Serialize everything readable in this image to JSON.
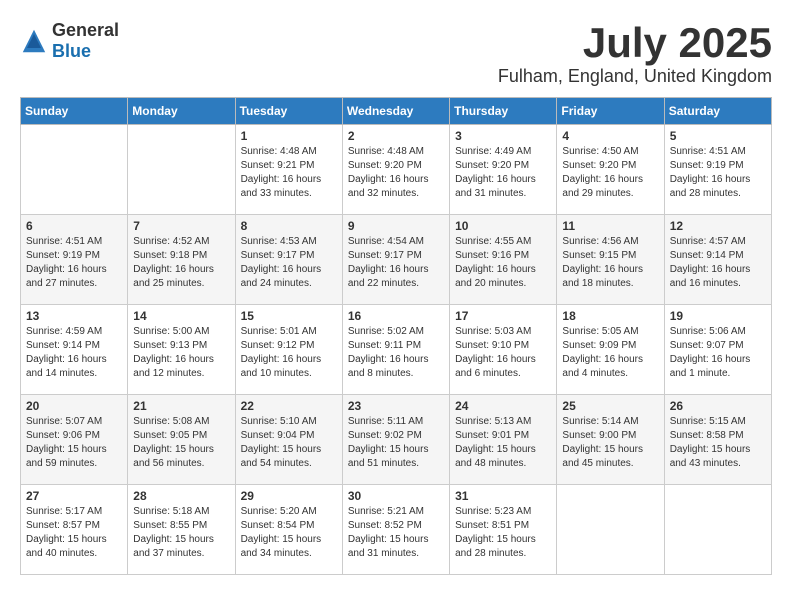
{
  "header": {
    "logo_general": "General",
    "logo_blue": "Blue",
    "month": "July 2025",
    "location": "Fulham, England, United Kingdom"
  },
  "days_of_week": [
    "Sunday",
    "Monday",
    "Tuesday",
    "Wednesday",
    "Thursday",
    "Friday",
    "Saturday"
  ],
  "weeks": [
    [
      {
        "day": "",
        "content": ""
      },
      {
        "day": "",
        "content": ""
      },
      {
        "day": "1",
        "content": "Sunrise: 4:48 AM\nSunset: 9:21 PM\nDaylight: 16 hours\nand 33 minutes."
      },
      {
        "day": "2",
        "content": "Sunrise: 4:48 AM\nSunset: 9:20 PM\nDaylight: 16 hours\nand 32 minutes."
      },
      {
        "day": "3",
        "content": "Sunrise: 4:49 AM\nSunset: 9:20 PM\nDaylight: 16 hours\nand 31 minutes."
      },
      {
        "day": "4",
        "content": "Sunrise: 4:50 AM\nSunset: 9:20 PM\nDaylight: 16 hours\nand 29 minutes."
      },
      {
        "day": "5",
        "content": "Sunrise: 4:51 AM\nSunset: 9:19 PM\nDaylight: 16 hours\nand 28 minutes."
      }
    ],
    [
      {
        "day": "6",
        "content": "Sunrise: 4:51 AM\nSunset: 9:19 PM\nDaylight: 16 hours\nand 27 minutes."
      },
      {
        "day": "7",
        "content": "Sunrise: 4:52 AM\nSunset: 9:18 PM\nDaylight: 16 hours\nand 25 minutes."
      },
      {
        "day": "8",
        "content": "Sunrise: 4:53 AM\nSunset: 9:17 PM\nDaylight: 16 hours\nand 24 minutes."
      },
      {
        "day": "9",
        "content": "Sunrise: 4:54 AM\nSunset: 9:17 PM\nDaylight: 16 hours\nand 22 minutes."
      },
      {
        "day": "10",
        "content": "Sunrise: 4:55 AM\nSunset: 9:16 PM\nDaylight: 16 hours\nand 20 minutes."
      },
      {
        "day": "11",
        "content": "Sunrise: 4:56 AM\nSunset: 9:15 PM\nDaylight: 16 hours\nand 18 minutes."
      },
      {
        "day": "12",
        "content": "Sunrise: 4:57 AM\nSunset: 9:14 PM\nDaylight: 16 hours\nand 16 minutes."
      }
    ],
    [
      {
        "day": "13",
        "content": "Sunrise: 4:59 AM\nSunset: 9:14 PM\nDaylight: 16 hours\nand 14 minutes."
      },
      {
        "day": "14",
        "content": "Sunrise: 5:00 AM\nSunset: 9:13 PM\nDaylight: 16 hours\nand 12 minutes."
      },
      {
        "day": "15",
        "content": "Sunrise: 5:01 AM\nSunset: 9:12 PM\nDaylight: 16 hours\nand 10 minutes."
      },
      {
        "day": "16",
        "content": "Sunrise: 5:02 AM\nSunset: 9:11 PM\nDaylight: 16 hours\nand 8 minutes."
      },
      {
        "day": "17",
        "content": "Sunrise: 5:03 AM\nSunset: 9:10 PM\nDaylight: 16 hours\nand 6 minutes."
      },
      {
        "day": "18",
        "content": "Sunrise: 5:05 AM\nSunset: 9:09 PM\nDaylight: 16 hours\nand 4 minutes."
      },
      {
        "day": "19",
        "content": "Sunrise: 5:06 AM\nSunset: 9:07 PM\nDaylight: 16 hours\nand 1 minute."
      }
    ],
    [
      {
        "day": "20",
        "content": "Sunrise: 5:07 AM\nSunset: 9:06 PM\nDaylight: 15 hours\nand 59 minutes."
      },
      {
        "day": "21",
        "content": "Sunrise: 5:08 AM\nSunset: 9:05 PM\nDaylight: 15 hours\nand 56 minutes."
      },
      {
        "day": "22",
        "content": "Sunrise: 5:10 AM\nSunset: 9:04 PM\nDaylight: 15 hours\nand 54 minutes."
      },
      {
        "day": "23",
        "content": "Sunrise: 5:11 AM\nSunset: 9:02 PM\nDaylight: 15 hours\nand 51 minutes."
      },
      {
        "day": "24",
        "content": "Sunrise: 5:13 AM\nSunset: 9:01 PM\nDaylight: 15 hours\nand 48 minutes."
      },
      {
        "day": "25",
        "content": "Sunrise: 5:14 AM\nSunset: 9:00 PM\nDaylight: 15 hours\nand 45 minutes."
      },
      {
        "day": "26",
        "content": "Sunrise: 5:15 AM\nSunset: 8:58 PM\nDaylight: 15 hours\nand 43 minutes."
      }
    ],
    [
      {
        "day": "27",
        "content": "Sunrise: 5:17 AM\nSunset: 8:57 PM\nDaylight: 15 hours\nand 40 minutes."
      },
      {
        "day": "28",
        "content": "Sunrise: 5:18 AM\nSunset: 8:55 PM\nDaylight: 15 hours\nand 37 minutes."
      },
      {
        "day": "29",
        "content": "Sunrise: 5:20 AM\nSunset: 8:54 PM\nDaylight: 15 hours\nand 34 minutes."
      },
      {
        "day": "30",
        "content": "Sunrise: 5:21 AM\nSunset: 8:52 PM\nDaylight: 15 hours\nand 31 minutes."
      },
      {
        "day": "31",
        "content": "Sunrise: 5:23 AM\nSunset: 8:51 PM\nDaylight: 15 hours\nand 28 minutes."
      },
      {
        "day": "",
        "content": ""
      },
      {
        "day": "",
        "content": ""
      }
    ]
  ]
}
